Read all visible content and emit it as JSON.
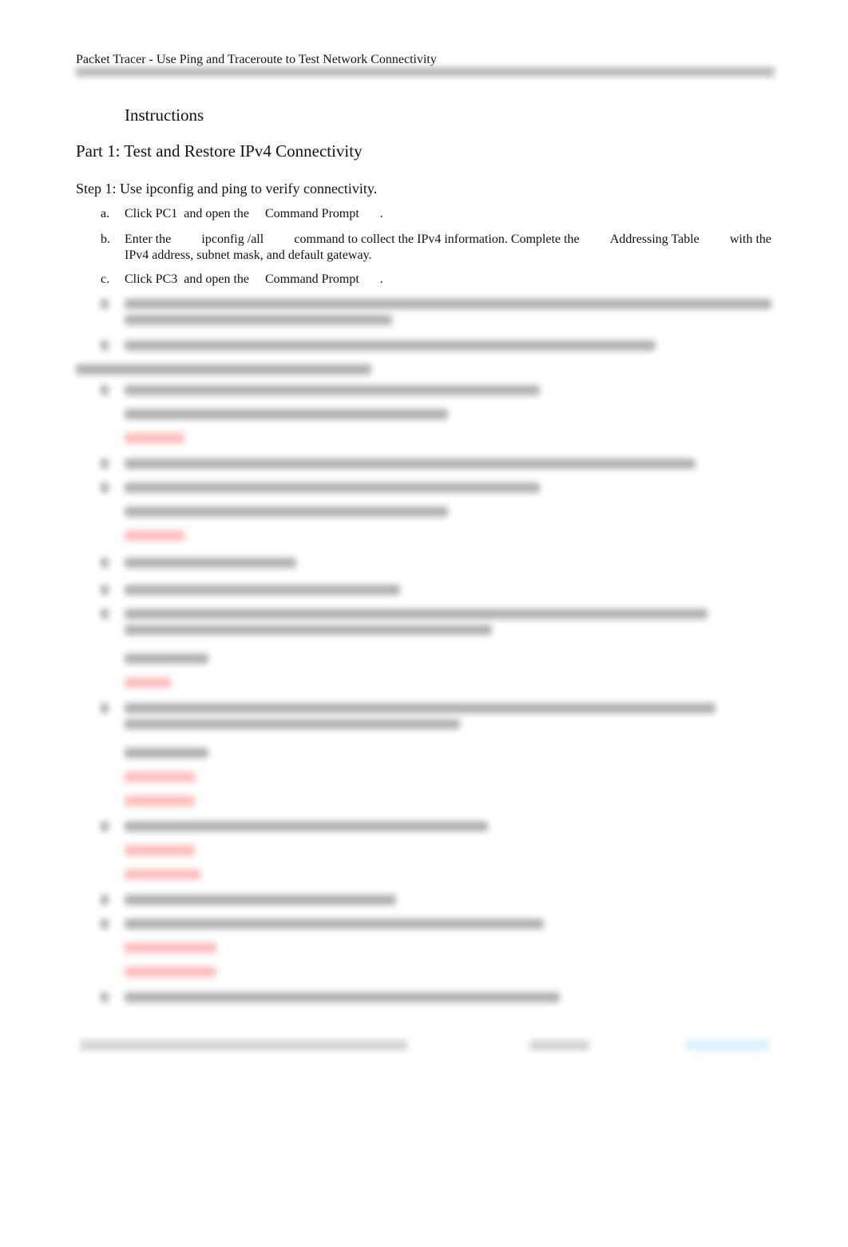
{
  "document": {
    "running_header": "Packet Tracer - Use Ping and Traceroute to Test Network Connectivity",
    "section_heading": "Instructions",
    "part_title": "Part 1: Test and Restore IPv4 Connectivity",
    "step_title": "Step 1: Use ipconfig and ping to verify connectivity.",
    "items": [
      {
        "letter": "a.",
        "parts": [
          "Click",
          "PC1",
          "and open the",
          "Command Prompt",
          "."
        ]
      },
      {
        "letter": "b.",
        "line1": [
          "Enter the",
          "ipconfig /all",
          "command to collect the IPv4 information. Complete the",
          "Addressing Table",
          "with the"
        ],
        "line2": "IPv4 address, subnet mask, and default gateway."
      },
      {
        "letter": "c.",
        "parts": [
          "Click",
          "PC3",
          "and open the",
          "Command Prompt",
          "."
        ]
      }
    ],
    "obscured_content_note": "Remaining content blurred (preview)"
  }
}
